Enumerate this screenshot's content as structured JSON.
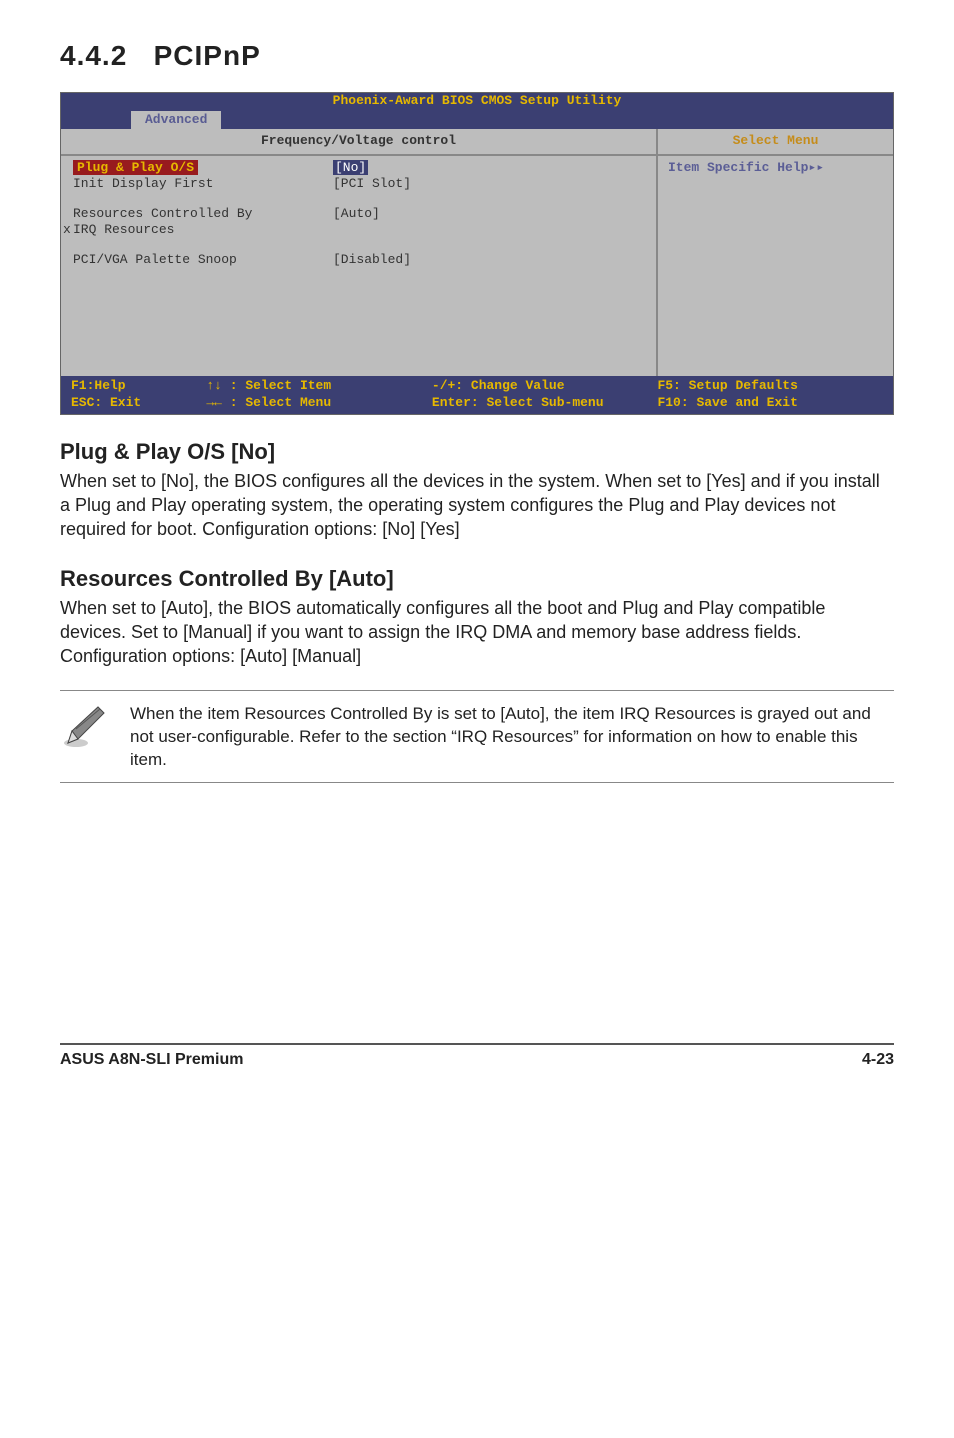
{
  "section": {
    "number": "4.4.2",
    "title": "PCIPnP"
  },
  "bios": {
    "top_title": "Phoenix-Award BIOS CMOS Setup Utility",
    "tab": "Advanced",
    "header_left": "Frequency/Voltage control",
    "header_right": "Select Menu",
    "rows": {
      "plug_play": {
        "label": "Plug & Play O/S",
        "value": "[No]"
      },
      "init_display": {
        "label": "Init Display First",
        "value": "[PCI Slot]"
      },
      "res_ctrl": {
        "label": "Resources Controlled By",
        "value": "[Auto]"
      },
      "irq_marker": "x",
      "irq_res": {
        "label": "IRQ Resources",
        "value": ""
      },
      "palette": {
        "label": "PCI/VGA Palette Snoop",
        "value": "[Disabled]"
      }
    },
    "help_title": "Item Specific Help▸▸",
    "footer": {
      "f1": "F1:Help",
      "select_item": "↑↓ : Select Item",
      "change_val": "-/+: Change Value",
      "f5": "F5: Setup Defaults",
      "esc": "ESC: Exit",
      "select_menu": "→← : Select Menu",
      "enter": "Enter: Select Sub-menu",
      "f10": "F10: Save and Exit"
    }
  },
  "h1": "Plug & Play O/S [No]",
  "p1": "When set to [No], the BIOS configures all the devices in the system. When set to [Yes] and if you install a Plug and Play operating system, the operating system configures the Plug and Play devices not required for boot. Configuration options: [No] [Yes]",
  "h2": "Resources Controlled By [Auto]",
  "p2a": "When set to [Auto], the BIOS automatically configures all the boot and Plug and Play compatible devices. Set to [Manual] if you want to assign the IRQ DMA and memory base address fields.",
  "p2b": "Configuration options: [Auto] [Manual]",
  "note": "When the item Resources Controlled By is set to [Auto], the item IRQ Resources is grayed out and not user-configurable. Refer to the section “IRQ Resources” for information on how to enable this item.",
  "footer_left": "ASUS A8N-SLI Premium",
  "footer_right": "4-23"
}
